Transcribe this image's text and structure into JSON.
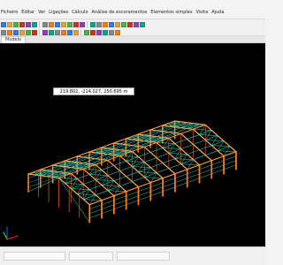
{
  "menu": {
    "items": [
      {
        "label": "Ficheiro",
        "name": "menu-ficheiro"
      },
      {
        "label": "Editar",
        "name": "menu-editar"
      },
      {
        "label": "Ver",
        "name": "menu-ver"
      },
      {
        "label": "Ligações",
        "name": "menu-ligacoes"
      },
      {
        "label": "Cálculo",
        "name": "menu-calculo"
      },
      {
        "label": "Análise de escoramentos",
        "name": "menu-analise-escoramentos"
      },
      {
        "label": "Elementos simples",
        "name": "menu-elementos-simples"
      },
      {
        "label": "Visita",
        "name": "menu-visita"
      },
      {
        "label": "Ajuda",
        "name": "menu-ajuda"
      }
    ]
  },
  "document": {
    "tab_label": "Modelo"
  },
  "viewport": {
    "coordinate_readout": "219.802, -214.027, 250.695 m",
    "background_color": "#000000"
  },
  "colors": {
    "columns": "#ff7a1c",
    "columns_dark": "#d4551a",
    "rafters": "#ffa14d",
    "purlins": "#36c8c8",
    "bracing": "#46e0b0",
    "axis_x": "#ff2020",
    "axis_y": "#20ff20",
    "axis_z": "#2060ff"
  },
  "icons": [
    "new-file-icon",
    "open-file-icon",
    "save-icon",
    "print-icon",
    "undo-icon",
    "redo-icon",
    "zoom-icon",
    "rotate-icon",
    "pan-icon",
    "select-icon",
    "beam-icon",
    "column-icon",
    "node-icon",
    "load-icon",
    "calc-icon",
    "view-3d-icon"
  ]
}
